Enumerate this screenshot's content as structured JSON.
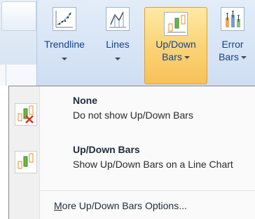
{
  "ribbon": {
    "buttons": [
      {
        "id": "trendline",
        "label_line1": "Trendline",
        "label_line2": "",
        "icon": "trendline-icon"
      },
      {
        "id": "lines",
        "label_line1": "Lines",
        "label_line2": "",
        "icon": "lines-icon"
      },
      {
        "id": "updown",
        "label_line1": "Up/Down",
        "label_line2": "Bars",
        "icon": "up-down-bars-icon"
      },
      {
        "id": "error",
        "label_line1": "Error",
        "label_line2": "Bars",
        "icon": "error-bars-icon"
      }
    ]
  },
  "menu": {
    "items": [
      {
        "title": "None",
        "desc": "Do not show Up/Down Bars",
        "icon": "no-up-down-bars-icon"
      },
      {
        "title": "Up/Down Bars",
        "desc": "Show Up/Down Bars on a Line Chart",
        "icon": "up-down-bars-icon"
      }
    ],
    "more_mnemonic": "M",
    "more_rest": "ore Up/Down Bars Options..."
  },
  "colors": {
    "accent": "#f7c15a",
    "label_blue": "#15428b",
    "error_x": "#e0312b"
  }
}
